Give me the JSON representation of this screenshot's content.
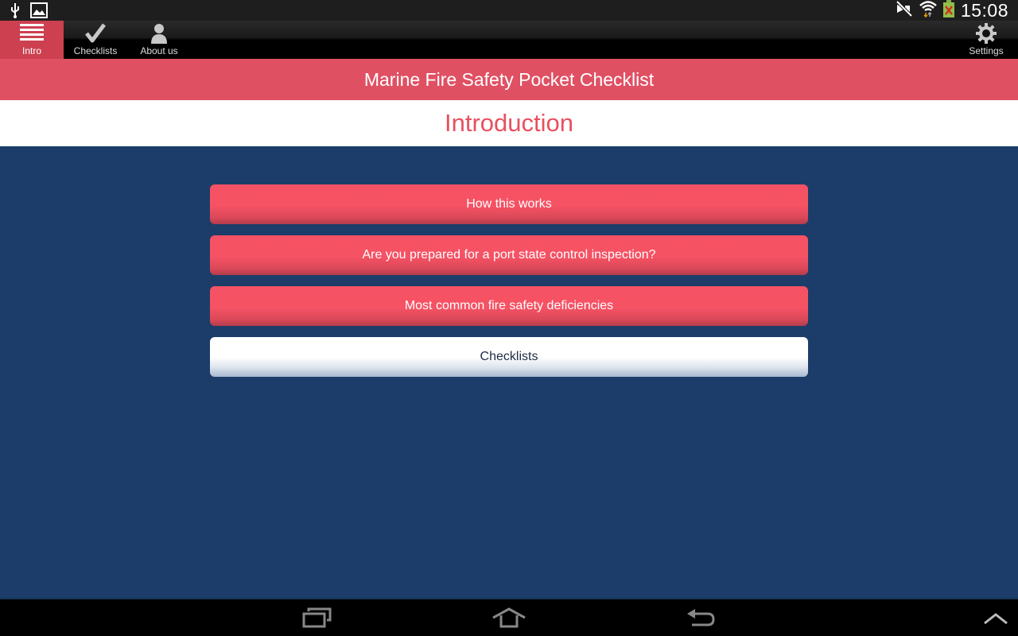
{
  "status_bar": {
    "time": "15:08",
    "icons": [
      "usb-icon",
      "gallery-icon",
      "mute-icon",
      "wifi-icon",
      "battery-missing-icon"
    ]
  },
  "action_bar": {
    "tabs": [
      {
        "label": "Intro",
        "icon": "menu-lines-icon",
        "active": true
      },
      {
        "label": "Checklists",
        "icon": "checkmark-icon",
        "active": false
      },
      {
        "label": "About us",
        "icon": "person-icon",
        "active": false
      }
    ],
    "settings_label": "Settings"
  },
  "header": {
    "app_title": "Marine Fire Safety Pocket Checklist",
    "page_title": "Introduction"
  },
  "menu": {
    "buttons": [
      {
        "label": "How this works",
        "style": "red"
      },
      {
        "label": "Are you prepared for a port state control inspection?",
        "style": "red"
      },
      {
        "label": "Most common fire safety deficiencies",
        "style": "red"
      },
      {
        "label": "Checklists",
        "style": "white"
      }
    ]
  },
  "colors": {
    "accent_red": "#e05063",
    "button_red": "#f55264",
    "background_navy": "#1c3d69"
  },
  "nav_bar": {
    "buttons": [
      "recent-apps-icon",
      "home-icon",
      "back-icon",
      "chevron-up-icon"
    ]
  }
}
